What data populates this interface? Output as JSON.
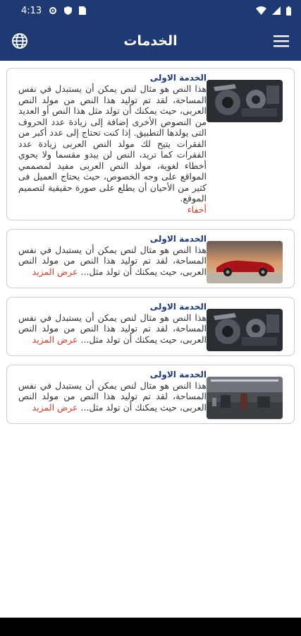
{
  "status_bar": {
    "time": "4:13"
  },
  "app_bar": {
    "title": "الخدمات"
  },
  "cards": [
    {
      "title": "الخدمة الاولى",
      "text": "هذا النص هو مثال لنص يمكن أن يستبدل في نفس المساحة، لقد تم توليد هذا النص من مولد النص العربى، حيث يمكنك أن تولد مثل هذا النص أو العديد من النصوص الأخرى إضافة إلى زيادة عدد الحروف التى يولدها التطبيق. إذا كنت تحتاج إلى عدد أكبر من الفقرات يتيح لك مولد النص العربى زيادة عدد الفقرات كما تريد، النص لن يبدو مقسما ولا يحوي أخطاء لغوية، مولد النص العربى مفيد لمصممي المواقع على وجه الخصوص، حيث يحتاج العميل فى كثير من الأحيان أن يطلع على صورة حقيقية لتصميم الموقع.",
      "link": "أخفاء",
      "image": "engine"
    },
    {
      "title": "الخدمة الاولى",
      "text": "هذا النص هو مثال لنص يمكن أن يستبدل في نفس المساحة، لقد تم توليد هذا النص من مولد النص العربى، حيث يمكنك أن تولد مثل...",
      "link": "عرض المزيد",
      "image": "red-car"
    },
    {
      "title": "الخدمة الاولى",
      "text": "هذا النص هو مثال لنص يمكن أن يستبدل في نفس المساحة، لقد تم توليد هذا النص من مولد النص العربى، حيث يمكنك أن تولد مثل...",
      "link": "عرض المزيد",
      "image": "engine"
    },
    {
      "title": "الخدمة الاولى",
      "text": "هذا النص هو مثال لنص يمكن أن يستبدل في نفس المساحة، لقد تم توليد هذا النص من مولد النص العربى، حيث يمكنك أن تولد مثل...",
      "link": "عرض المزيد",
      "image": "workshop"
    }
  ],
  "colors": {
    "primary": "#1f3a73",
    "link": "#d03b2a",
    "card_border": "#c9cbd4"
  }
}
